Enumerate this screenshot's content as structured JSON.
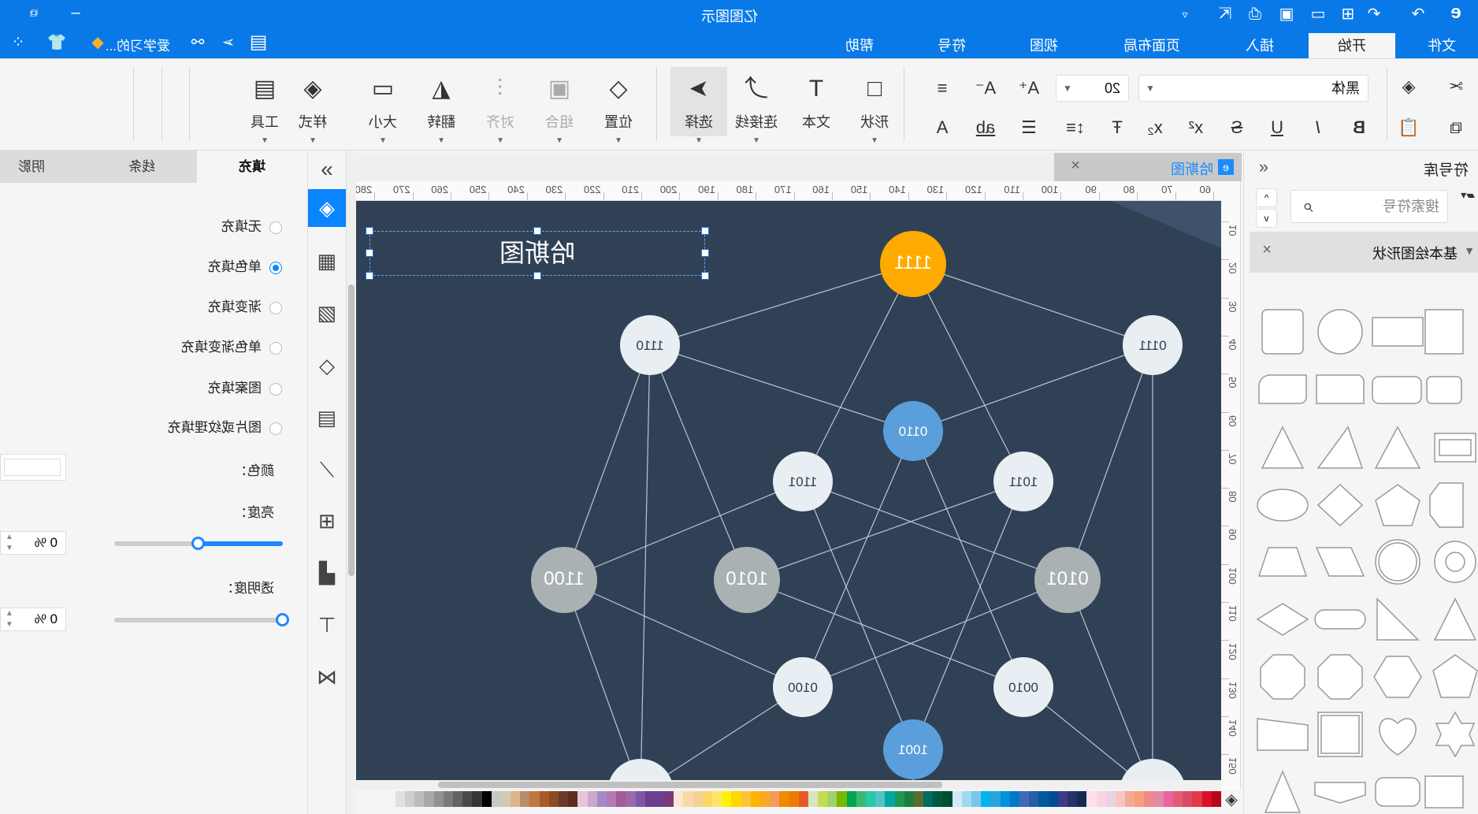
{
  "app": {
    "title": "亿图图示",
    "accent": "#0a79e8"
  },
  "titlebar": {
    "icons": [
      "app-logo-icon",
      "redo-icon",
      "undo-icon",
      "new-icon",
      "open-icon",
      "save-icon",
      "print-icon",
      "export-icon",
      "customize-icon"
    ],
    "window": [
      "minimize-icon",
      "restore-icon"
    ]
  },
  "menu": {
    "tabs": [
      {
        "label": "文件"
      },
      {
        "label": "开始",
        "active": true
      },
      {
        "label": "插入"
      },
      {
        "label": "页面布局"
      },
      {
        "label": "视图"
      },
      {
        "label": "符号"
      },
      {
        "label": "帮助"
      }
    ],
    "user": "爱学习的..."
  },
  "ribbon": {
    "font_name": "黑体",
    "font_size": "20",
    "buttons": [
      {
        "label": "形状"
      },
      {
        "label": "文本"
      },
      {
        "label": "连接线"
      },
      {
        "label": "选择"
      },
      {
        "label": "位置"
      },
      {
        "label": "组合"
      },
      {
        "label": "对齐"
      },
      {
        "label": "翻转"
      },
      {
        "label": "大小"
      },
      {
        "label": "样式"
      },
      {
        "label": "工具"
      }
    ]
  },
  "library": {
    "title": "符号库",
    "search_placeholder": "搜索符号",
    "section": "基本绘图形状"
  },
  "document": {
    "tab": "哈斯图"
  },
  "rulers": {
    "h": [
      60,
      70,
      80,
      90,
      100,
      110,
      120,
      130,
      140,
      150,
      160,
      170,
      180,
      190,
      200,
      210,
      220,
      230,
      240,
      250,
      260,
      270,
      280
    ],
    "v": [
      10,
      20,
      30,
      40,
      50,
      60,
      70,
      80,
      90,
      100,
      110,
      120,
      130,
      140,
      150
    ]
  },
  "diagram": {
    "title": "哈斯图",
    "background": "#304156",
    "colors": {
      "top": "#ffaa00",
      "blue": "#5a9fdc",
      "grey": "#a9b1b3",
      "light": "#e8eef2"
    },
    "nodes": [
      {
        "label": "1111",
        "style": "top"
      },
      {
        "label": "1110",
        "style": "light"
      },
      {
        "label": "0111",
        "style": "light"
      },
      {
        "label": "0110",
        "style": "blue"
      },
      {
        "label": "1101",
        "style": "light"
      },
      {
        "label": "1011",
        "style": "light"
      },
      {
        "label": "1100",
        "style": "grey"
      },
      {
        "label": "1010",
        "style": "grey"
      },
      {
        "label": "0101",
        "style": "grey"
      },
      {
        "label": "0100",
        "style": "light"
      },
      {
        "label": "0010",
        "style": "light"
      },
      {
        "label": "1001",
        "style": "blue"
      }
    ]
  },
  "properties": {
    "tabs": [
      "填充",
      "线条",
      "阴影"
    ],
    "fill_options": [
      {
        "label": "无填充",
        "checked": false
      },
      {
        "label": "单色填充",
        "checked": true
      },
      {
        "label": "渐变填充",
        "checked": false
      },
      {
        "label": "单色渐变填充",
        "checked": false
      },
      {
        "label": "图案填充",
        "checked": false
      },
      {
        "label": "图片或纹理填充",
        "checked": false
      }
    ],
    "color_label": "颜色：",
    "color_value": "#ffffff",
    "brightness_label": "亮度：",
    "brightness": "0 %",
    "brightness_level": 0,
    "transparency_label": "透明度：",
    "transparency": "0 %",
    "transparency_level": 0
  },
  "palette": [
    "#f5f5f5",
    "#e0e0e0",
    "#cfcfcf",
    "#bdbdbd",
    "#a8a8a8",
    "#929292",
    "#7a7a7a",
    "#636363",
    "#4a4a4a",
    "#3a3535",
    "#000000",
    "#c9c9bf",
    "#d3c9b8",
    "#dcb58a",
    "#b98c6e",
    "#c0783e",
    "#a85a2a",
    "#8d4a26",
    "#6e3a25",
    "#5c2e1e",
    "#e9c3d9",
    "#cfa6cc",
    "#a68ac6",
    "#b27bb5",
    "#a25c96",
    "#9b6aa8",
    "#7e57a4",
    "#6a3f8f",
    "#6b3e91",
    "#7a3a7a",
    "#fde7cf",
    "#fbd9a5",
    "#f5d09a",
    "#fcd66b",
    "#fde56a",
    "#fff200",
    "#ffd800",
    "#fcc43a",
    "#ffb400",
    "#f9a825",
    "#f39c5a",
    "#f08a00",
    "#ee7a00",
    "#e65a2a",
    "#d3e6c3",
    "#c3dc52",
    "#a5cf6b",
    "#7ab800",
    "#00a651",
    "#3db874",
    "#26c9a8",
    "#54c2c2",
    "#00a99d",
    "#1f9850",
    "#1a7f45",
    "#5a6b30",
    "#006b5f",
    "#005a3c",
    "#004d35",
    "#d3eaf5",
    "#a0d8ef",
    "#7cc5ea",
    "#00b5ef",
    "#2aa3e0",
    "#0093d8",
    "#0077c8",
    "#3d6bb7",
    "#2a5ca8",
    "#00599c",
    "#004b93",
    "#3e3a86",
    "#26326b",
    "#162a55",
    "#fde1e7",
    "#fad4e0",
    "#e9d3e3",
    "#f5c6c6",
    "#f4aa95",
    "#f69f7d",
    "#f08a8a",
    "#e08aa5",
    "#e964a3",
    "#e35b75",
    "#d94a64",
    "#e63946",
    "#d7112b",
    "#b5081a"
  ]
}
